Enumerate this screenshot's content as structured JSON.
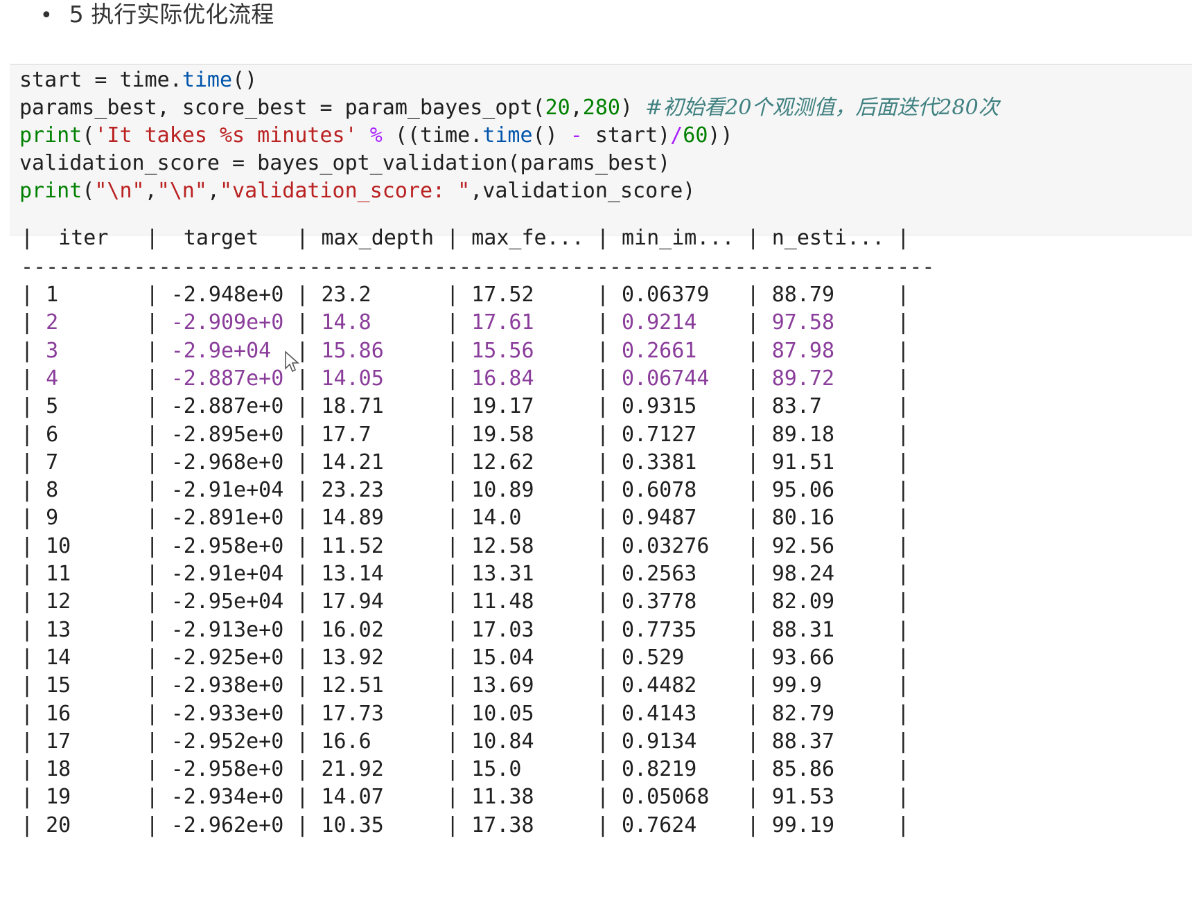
{
  "markdown": {
    "bullet_text": "5 执行实际优化流程"
  },
  "code_cell": {
    "lines": [
      [
        {
          "t": "start = time."
        },
        {
          "t": "time",
          "c": "attr"
        },
        {
          "t": "()"
        }
      ],
      [
        {
          "t": "params_best, score_best = param_bayes_opt("
        },
        {
          "t": "20",
          "c": "num"
        },
        {
          "t": ","
        },
        {
          "t": "280",
          "c": "num"
        },
        {
          "t": ") "
        },
        {
          "t": "#初始看20个观测值，后面迭代280次",
          "c": "cmt"
        }
      ],
      [
        {
          "t": "print",
          "c": "kw-print"
        },
        {
          "t": "("
        },
        {
          "t": "'It takes %s minutes'",
          "c": "str"
        },
        {
          "t": " "
        },
        {
          "t": "%",
          "c": "op"
        },
        {
          "t": " ((time."
        },
        {
          "t": "time",
          "c": "attr"
        },
        {
          "t": "() "
        },
        {
          "t": "-",
          "c": "op"
        },
        {
          "t": " start)"
        },
        {
          "t": "/",
          "c": "op"
        },
        {
          "t": "60",
          "c": "num"
        },
        {
          "t": "))"
        }
      ],
      [
        {
          "t": "validation_score = bayes_opt_validation(params_best)"
        }
      ],
      [
        {
          "t": "print",
          "c": "kw-print"
        },
        {
          "t": "("
        },
        {
          "t": "\"\\n\"",
          "c": "str"
        },
        {
          "t": ","
        },
        {
          "t": "\"\\n\"",
          "c": "str"
        },
        {
          "t": ","
        },
        {
          "t": "\"validation_score: \"",
          "c": "str"
        },
        {
          "t": ",validation_score)"
        }
      ]
    ]
  },
  "output_table": {
    "columns": [
      "iter",
      "target",
      "max_depth",
      "max_fe...",
      "min_im...",
      "n_esti..."
    ],
    "separator": "-------------------------------------------------------------------------",
    "rows": [
      {
        "iter": "1",
        "target": "-2.948e+0",
        "max_depth": "23.2",
        "max_fe": "17.52",
        "min_im": "0.06379",
        "n_esti": "88.79",
        "highlight": false
      },
      {
        "iter": "2",
        "target": "-2.909e+0",
        "max_depth": "14.8",
        "max_fe": "17.61",
        "min_im": "0.9214",
        "n_esti": "97.58",
        "highlight": true
      },
      {
        "iter": "3",
        "target": "-2.9e+04",
        "max_depth": "15.86",
        "max_fe": "15.56",
        "min_im": "0.2661",
        "n_esti": "87.98",
        "highlight": true
      },
      {
        "iter": "4",
        "target": "-2.887e+0",
        "max_depth": "14.05",
        "max_fe": "16.84",
        "min_im": "0.06744",
        "n_esti": "89.72",
        "highlight": true
      },
      {
        "iter": "5",
        "target": "-2.887e+0",
        "max_depth": "18.71",
        "max_fe": "19.17",
        "min_im": "0.9315",
        "n_esti": "83.7",
        "highlight": false
      },
      {
        "iter": "6",
        "target": "-2.895e+0",
        "max_depth": "17.7",
        "max_fe": "19.58",
        "min_im": "0.7127",
        "n_esti": "89.18",
        "highlight": false
      },
      {
        "iter": "7",
        "target": "-2.968e+0",
        "max_depth": "14.21",
        "max_fe": "12.62",
        "min_im": "0.3381",
        "n_esti": "91.51",
        "highlight": false
      },
      {
        "iter": "8",
        "target": "-2.91e+04",
        "max_depth": "23.23",
        "max_fe": "10.89",
        "min_im": "0.6078",
        "n_esti": "95.06",
        "highlight": false
      },
      {
        "iter": "9",
        "target": "-2.891e+0",
        "max_depth": "14.89",
        "max_fe": "14.0",
        "min_im": "0.9487",
        "n_esti": "80.16",
        "highlight": false
      },
      {
        "iter": "10",
        "target": "-2.958e+0",
        "max_depth": "11.52",
        "max_fe": "12.58",
        "min_im": "0.03276",
        "n_esti": "92.56",
        "highlight": false
      },
      {
        "iter": "11",
        "target": "-2.91e+04",
        "max_depth": "13.14",
        "max_fe": "13.31",
        "min_im": "0.2563",
        "n_esti": "98.24",
        "highlight": false
      },
      {
        "iter": "12",
        "target": "-2.95e+04",
        "max_depth": "17.94",
        "max_fe": "11.48",
        "min_im": "0.3778",
        "n_esti": "82.09",
        "highlight": false
      },
      {
        "iter": "13",
        "target": "-2.913e+0",
        "max_depth": "16.02",
        "max_fe": "17.03",
        "min_im": "0.7735",
        "n_esti": "88.31",
        "highlight": false
      },
      {
        "iter": "14",
        "target": "-2.925e+0",
        "max_depth": "13.92",
        "max_fe": "15.04",
        "min_im": "0.529",
        "n_esti": "93.66",
        "highlight": false
      },
      {
        "iter": "15",
        "target": "-2.938e+0",
        "max_depth": "12.51",
        "max_fe": "13.69",
        "min_im": "0.4482",
        "n_esti": "99.9",
        "highlight": false
      },
      {
        "iter": "16",
        "target": "-2.933e+0",
        "max_depth": "17.73",
        "max_fe": "10.05",
        "min_im": "0.4143",
        "n_esti": "82.79",
        "highlight": false
      },
      {
        "iter": "17",
        "target": "-2.952e+0",
        "max_depth": "16.6",
        "max_fe": "10.84",
        "min_im": "0.9134",
        "n_esti": "88.37",
        "highlight": false
      },
      {
        "iter": "18",
        "target": "-2.958e+0",
        "max_depth": "21.92",
        "max_fe": "15.0",
        "min_im": "0.8219",
        "n_esti": "85.86",
        "highlight": false
      },
      {
        "iter": "19",
        "target": "-2.934e+0",
        "max_depth": "14.07",
        "max_fe": "11.38",
        "min_im": "0.05068",
        "n_esti": "91.53",
        "highlight": false
      },
      {
        "iter": "20",
        "target": "-2.962e+0",
        "max_depth": "10.35",
        "max_fe": "17.38",
        "min_im": "0.7624",
        "n_esti": "99.19",
        "highlight": false
      }
    ]
  },
  "colors": {
    "code_bg": "#f6f6f6",
    "print_builtin": "#008000",
    "string": "#ba2121",
    "highlight_row": "#8a3d9a"
  }
}
